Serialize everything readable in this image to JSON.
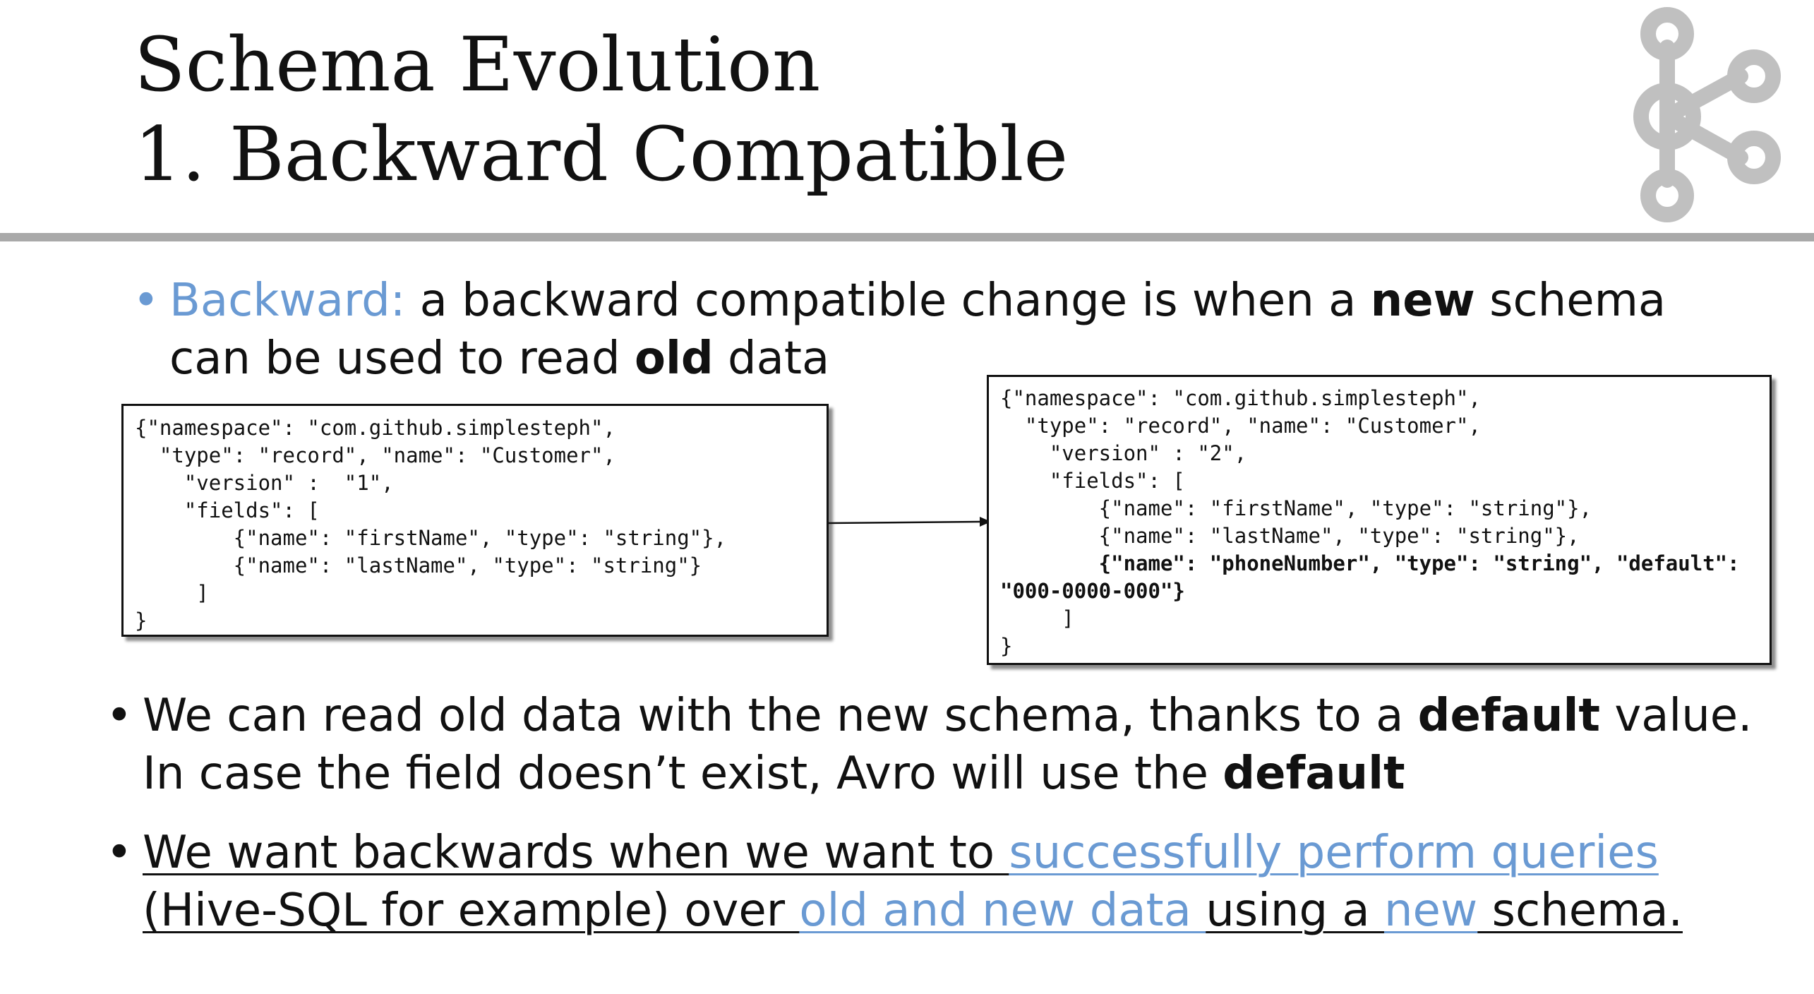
{
  "slide": {
    "title_line1": "Schema Evolution",
    "title_line2": "1. Backward Compatible",
    "logo": "kafka-logo-icon"
  },
  "bullet1": {
    "term": "Backward:",
    "text_a": " a backward compatible change is when a ",
    "bold_new": "new",
    "text_b": " schema can be used to read ",
    "bold_old": "old",
    "text_c": " data"
  },
  "schema_v1": {
    "lines": [
      "{\"namespace\": \"com.github.simplesteph\",",
      "  \"type\": \"record\", \"name\": \"Customer\",",
      "    \"version\" :  \"1\",",
      "    \"fields\": [",
      "        {\"name\": \"firstName\", \"type\": \"string\"},",
      "        {\"name\": \"lastName\", \"type\": \"string\"}",
      "     ]",
      "}"
    ]
  },
  "schema_v2": {
    "lines": [
      "{\"namespace\": \"com.github.simplesteph\",",
      "  \"type\": \"record\", \"name\": \"Customer\",",
      "    \"version\" : \"2\",",
      "    \"fields\": [",
      "        {\"name\": \"firstName\", \"type\": \"string\"},",
      "        {\"name\": \"lastName\", \"type\": \"string\"},"
    ],
    "bold_line_1": "        {\"name\": \"phoneNumber\", \"type\": \"string\", \"default\":",
    "bold_line_2": "\"000-0000-000\"}",
    "closing_1": "     ]",
    "closing_2": "}"
  },
  "bullet2": {
    "text_a": "We can read old data with the new schema, thanks to a ",
    "bold_default_1": "default",
    "text_b": " value. In case the field doesn’t exist, Avro will use the ",
    "bold_default_2": "default"
  },
  "bullet3": {
    "text_a": "We want backwards when we want to ",
    "link_1": "successfully perform queries",
    "text_b": " (Hive-SQL for example) over ",
    "link_2": "old and new data ",
    "text_c": "using a ",
    "link_3": "new",
    "text_d": " schema."
  },
  "colors": {
    "accent": "#6a9ad3",
    "rule": "#a9a9a9",
    "logo": "#c0c0c0"
  }
}
